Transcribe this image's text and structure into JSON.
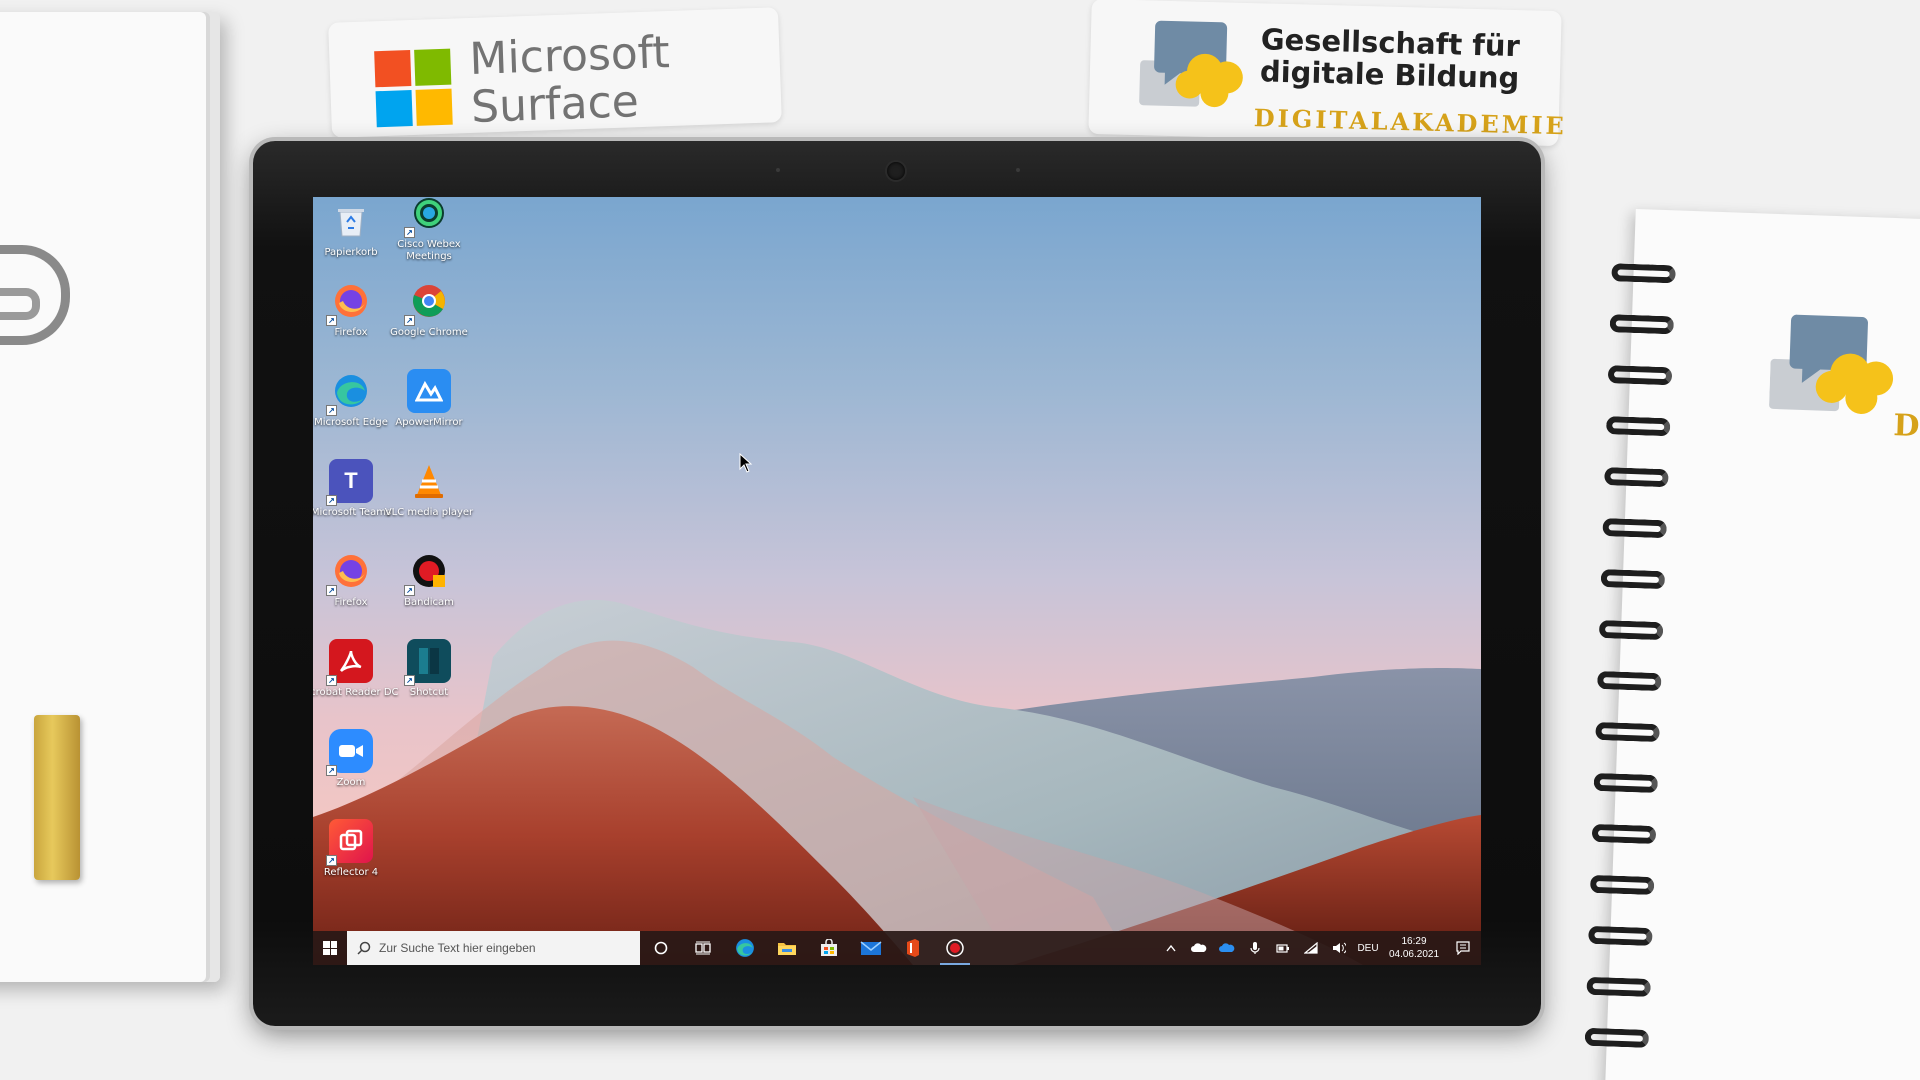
{
  "branding": {
    "microsoft_line1": "Microsoft",
    "microsoft_line2": "Surface",
    "gdb_line1": "Gesellschaft für",
    "gdb_line2": "digitale Bildung",
    "gdb_sub": "DIGITALAKADEMIE",
    "notepad_fragment": "D"
  },
  "desktop": {
    "icons": [
      {
        "label": "Papierkorb",
        "icon": "recycle-bin-icon"
      },
      {
        "label": "Cisco Webex Meetings",
        "icon": "webex-icon"
      },
      {
        "label": "Firefox",
        "icon": "firefox-icon"
      },
      {
        "label": "Google Chrome",
        "icon": "chrome-icon"
      },
      {
        "label": "Microsoft Edge",
        "icon": "edge-icon"
      },
      {
        "label": "ApowerMirror",
        "icon": "apowermirror-icon"
      },
      {
        "label": "Microsoft Teams",
        "icon": "teams-icon"
      },
      {
        "label": "VLC media player",
        "icon": "vlc-icon"
      },
      {
        "label": "Firefox",
        "icon": "firefox-icon"
      },
      {
        "label": "Bandicam",
        "icon": "bandicam-icon"
      },
      {
        "label": "Acrobat Reader DC",
        "icon": "acrobat-icon"
      },
      {
        "label": "Shotcut",
        "icon": "shotcut-icon"
      },
      {
        "label": "Zoom",
        "icon": "zoom-icon"
      },
      {
        "label": "Reflector 4",
        "icon": "reflector-icon"
      }
    ]
  },
  "taskbar": {
    "search_placeholder": "Zur Suche Text hier eingeben",
    "language": "DEU",
    "time": "16:29",
    "date": "04.06.2021",
    "pinned": [
      "cortana-icon",
      "task-view-icon",
      "edge-icon",
      "file-explorer-icon",
      "store-icon",
      "mail-icon",
      "office-icon",
      "record-icon"
    ],
    "tray": [
      "show-hidden-icon",
      "onedrive-icon",
      "onedrive-business-icon",
      "microphone-icon",
      "battery-icon",
      "wifi-icon",
      "volume-icon"
    ]
  },
  "colors": {
    "taskbar_bg": "#28181a",
    "accent": "#7aa9e0"
  }
}
